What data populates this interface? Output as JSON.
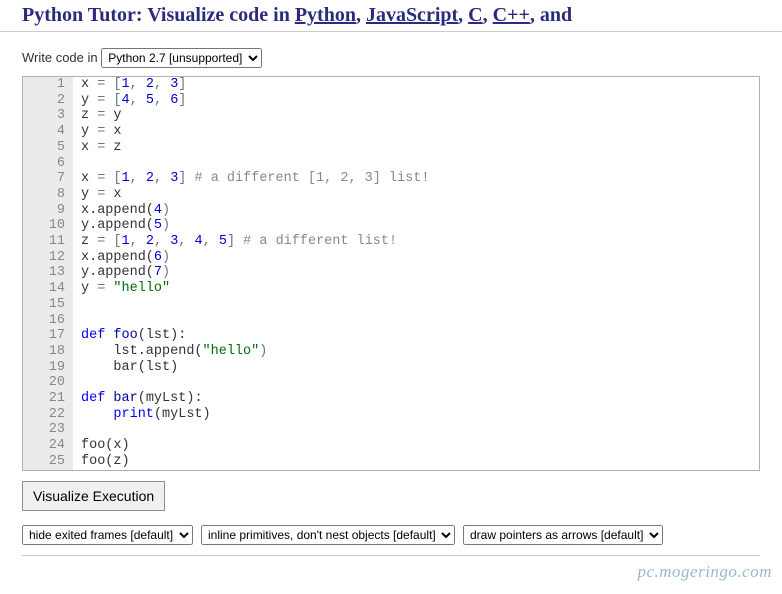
{
  "header": {
    "prefix": "Python Tutor: Visualize code in ",
    "links": [
      "Python",
      "JavaScript",
      "C",
      "C++"
    ],
    "suffix": ", and"
  },
  "topControls": {
    "label": "Write code in ",
    "languageSelected": "Python 2.7 [unsupported]"
  },
  "code": {
    "lines": [
      [
        [
          "",
          "x "
        ],
        [
          "op",
          "="
        ],
        [
          "",
          " "
        ],
        [
          "op",
          "["
        ],
        [
          "num",
          "1"
        ],
        [
          "op",
          ","
        ],
        [
          "",
          " "
        ],
        [
          "num",
          "2"
        ],
        [
          "op",
          ","
        ],
        [
          "",
          " "
        ],
        [
          "num",
          "3"
        ],
        [
          "op",
          "]"
        ]
      ],
      [
        [
          "",
          "y "
        ],
        [
          "op",
          "="
        ],
        [
          "",
          " "
        ],
        [
          "op",
          "["
        ],
        [
          "num",
          "4"
        ],
        [
          "op",
          ","
        ],
        [
          "",
          " "
        ],
        [
          "num",
          "5"
        ],
        [
          "op",
          ","
        ],
        [
          "",
          " "
        ],
        [
          "num",
          "6"
        ],
        [
          "op",
          "]"
        ]
      ],
      [
        [
          "",
          "z "
        ],
        [
          "op",
          "="
        ],
        [
          "",
          " y"
        ]
      ],
      [
        [
          "",
          "y "
        ],
        [
          "op",
          "="
        ],
        [
          "",
          " x"
        ]
      ],
      [
        [
          "",
          "x "
        ],
        [
          "op",
          "="
        ],
        [
          "",
          " z"
        ]
      ],
      [],
      [
        [
          "",
          "x "
        ],
        [
          "op",
          "="
        ],
        [
          "",
          " "
        ],
        [
          "op",
          "["
        ],
        [
          "num",
          "1"
        ],
        [
          "op",
          ","
        ],
        [
          "",
          " "
        ],
        [
          "num",
          "2"
        ],
        [
          "op",
          ","
        ],
        [
          "",
          " "
        ],
        [
          "num",
          "3"
        ],
        [
          "op",
          "]"
        ],
        [
          "",
          " "
        ],
        [
          "com",
          "# a different [1, 2, 3] list!"
        ]
      ],
      [
        [
          "",
          "y "
        ],
        [
          "op",
          "="
        ],
        [
          "",
          " x"
        ]
      ],
      [
        [
          "",
          "x.append("
        ],
        [
          "num",
          "4"
        ],
        [
          "op",
          ")"
        ]
      ],
      [
        [
          "",
          "y.append("
        ],
        [
          "num",
          "5"
        ],
        [
          "op",
          ")"
        ]
      ],
      [
        [
          "",
          "z "
        ],
        [
          "op",
          "="
        ],
        [
          "",
          " "
        ],
        [
          "op",
          "["
        ],
        [
          "num",
          "1"
        ],
        [
          "op",
          ","
        ],
        [
          "",
          " "
        ],
        [
          "num",
          "2"
        ],
        [
          "op",
          ","
        ],
        [
          "",
          " "
        ],
        [
          "num",
          "3"
        ],
        [
          "op",
          ","
        ],
        [
          "",
          " "
        ],
        [
          "num",
          "4"
        ],
        [
          "op",
          ","
        ],
        [
          "",
          " "
        ],
        [
          "num",
          "5"
        ],
        [
          "op",
          "]"
        ],
        [
          "",
          " "
        ],
        [
          "com",
          "# a different list!"
        ]
      ],
      [
        [
          "",
          "x.append("
        ],
        [
          "num",
          "6"
        ],
        [
          "op",
          ")"
        ]
      ],
      [
        [
          "",
          "y.append("
        ],
        [
          "num",
          "7"
        ],
        [
          "op",
          ")"
        ]
      ],
      [
        [
          "",
          "y "
        ],
        [
          "op",
          "="
        ],
        [
          "",
          " "
        ],
        [
          "str",
          "\"hello\""
        ]
      ],
      [],
      [],
      [
        [
          "kw",
          "def"
        ],
        [
          "",
          " "
        ],
        [
          "def",
          "foo"
        ],
        [
          "",
          "(lst):"
        ]
      ],
      [
        [
          "",
          "    lst.append("
        ],
        [
          "str",
          "\"hello\""
        ],
        [
          "op",
          ")"
        ]
      ],
      [
        [
          "",
          "    bar(lst)"
        ]
      ],
      [],
      [
        [
          "kw",
          "def"
        ],
        [
          "",
          " "
        ],
        [
          "def",
          "bar"
        ],
        [
          "",
          "(myLst):"
        ]
      ],
      [
        [
          "",
          "    "
        ],
        [
          "kw",
          "print"
        ],
        [
          "",
          "(myLst)"
        ]
      ],
      [],
      [
        [
          "",
          "foo(x)"
        ]
      ],
      [
        [
          "",
          "foo(z)"
        ]
      ]
    ]
  },
  "buttons": {
    "visualize": "Visualize Execution"
  },
  "options": {
    "frames": "hide exited frames [default]",
    "primitives": "inline primitives, don't nest objects [default]",
    "pointers": "draw pointers as arrows [default]"
  },
  "watermark": "pc.mogeringo.com"
}
